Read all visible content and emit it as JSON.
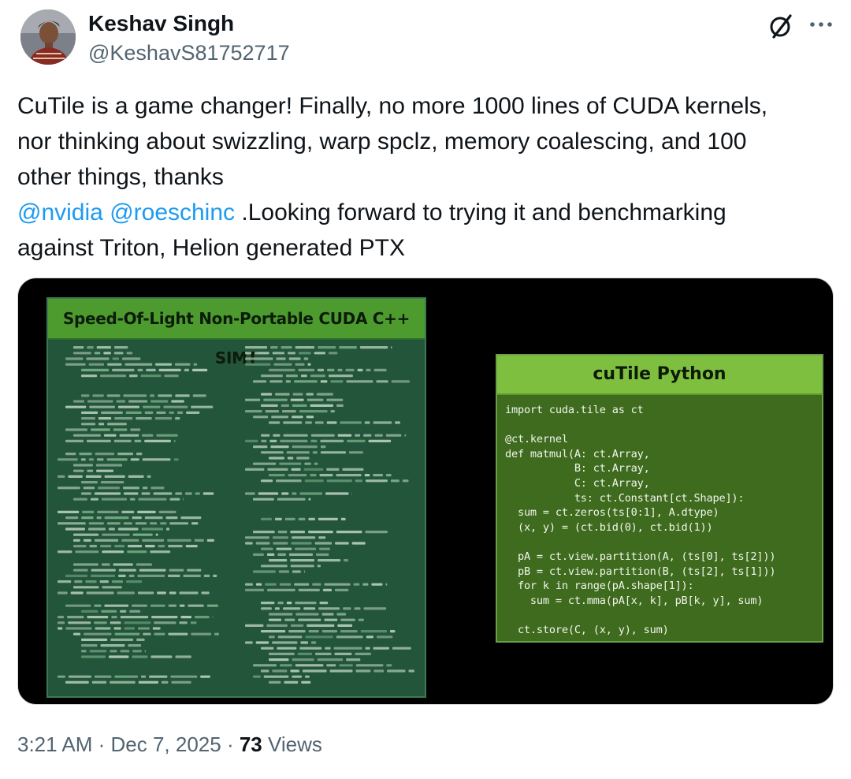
{
  "author": {
    "name": "Keshav Singh",
    "handle": "@KeshavS81752717"
  },
  "tweet": {
    "line1": "CuTile is a game changer! Finally, no more 1000 lines of CUDA kernels,",
    "line2": "nor thinking about swizzling, warp spclz, memory coalescing, and 100",
    "line3": "other things, thanks",
    "mention1": "@nvidia",
    "mention2": "@roeschinc",
    "line4_rest": " .Looking forward to trying it and benchmarking",
    "line5": "against Triton, Helion generated PTX"
  },
  "media": {
    "left_panel_title": "Speed-Of-Light Non-Portable CUDA C++ SIMT",
    "right_panel_title": "cuTile Python",
    "code_lines": [
      "import cuda.tile as ct",
      "",
      "@ct.kernel",
      "def matmul(A: ct.Array,",
      "           B: ct.Array,",
      "           C: ct.Array,",
      "           ts: ct.Constant[ct.Shape]):",
      "  sum = ct.zeros(ts[0:1], A.dtype)",
      "  (x, y) = (ct.bid(0), ct.bid(1))",
      "",
      "  pA = ct.view.partition(A, (ts[0], ts[2]))",
      "  pB = ct.view.partition(B, (ts[2], ts[1]))",
      "  for k in range(pA.shape[1]):",
      "    sum = ct.mma(pA[x, k], pB[k, y], sum)",
      "",
      "  ct.store(C, (x, y), sum)"
    ]
  },
  "meta": {
    "time": "3:21 AM",
    "sep1": " · ",
    "date": "Dec 7, 2025",
    "sep2": " · ",
    "views_count": "73",
    "views_label": " Views"
  },
  "icons": {
    "grok": "grok-slash-icon",
    "more": "more-dots-icon"
  },
  "colors": {
    "link": "#1d9bf0",
    "secondary_text": "#536471",
    "simt_header": "#4d9b2e",
    "cutile_header": "#7fbf3f"
  }
}
